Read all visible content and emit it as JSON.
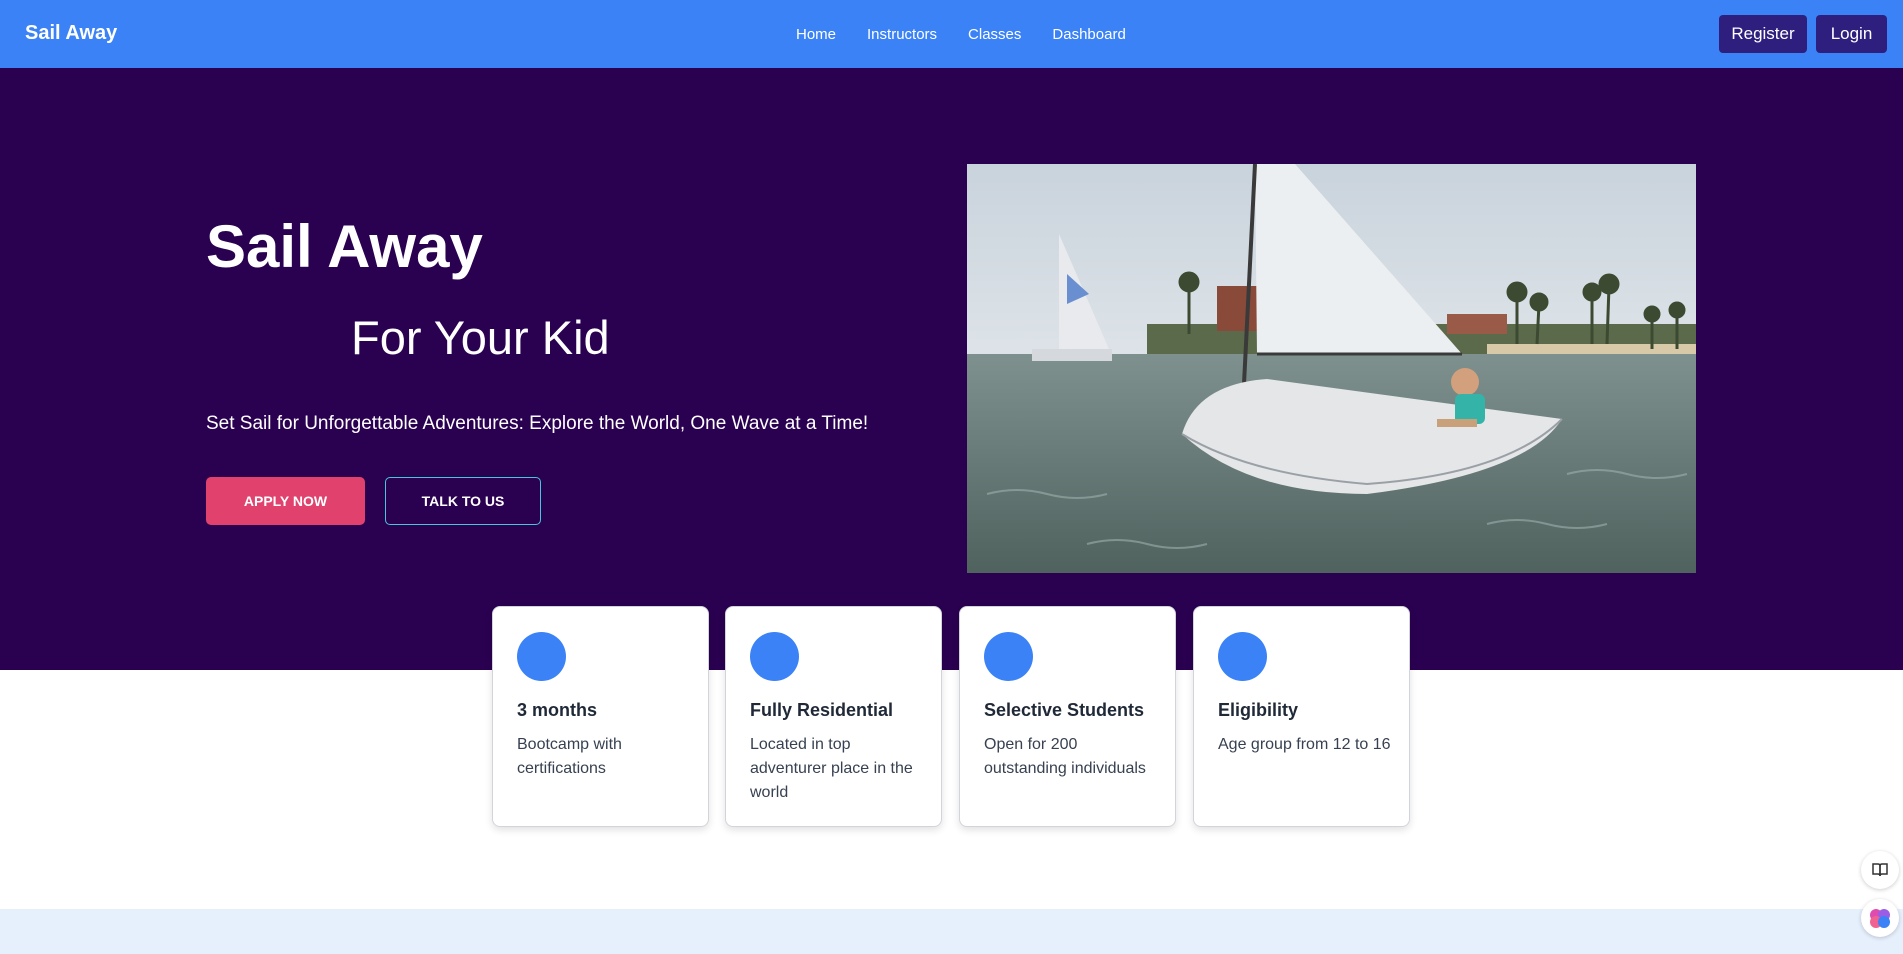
{
  "navbar": {
    "brand": "Sail Away",
    "links": [
      "Home",
      "Instructors",
      "Classes",
      "Dashboard"
    ],
    "register": "Register",
    "login": "Login"
  },
  "hero": {
    "title": "Sail Away",
    "subtitle": "For Your Kid",
    "tagline": "Set Sail for Unforgettable Adventures: Explore the World, One Wave at a Time!",
    "apply_button": "APPLY NOW",
    "talk_button": "TALK TO US"
  },
  "features": [
    {
      "title": "3 months",
      "description": "Bootcamp with certifications"
    },
    {
      "title": "Fully Residential",
      "description": "Located in top adventurer place in the world"
    },
    {
      "title": "Selective Students",
      "description": "Open for 200 outstanding individuals"
    },
    {
      "title": "Eligibility",
      "description": "Age group from 12 to 16"
    }
  ],
  "colors": {
    "navbar": "#3b82f6",
    "hero_background": "#2a0050",
    "auth_button": "#2e1f7e",
    "apply_button": "#e0416d",
    "accent_dot": "#3b82f6",
    "bottom_band": "#e6f0fd"
  },
  "icons": {
    "reader": "book-open-icon",
    "assistant": "brain-icon"
  }
}
